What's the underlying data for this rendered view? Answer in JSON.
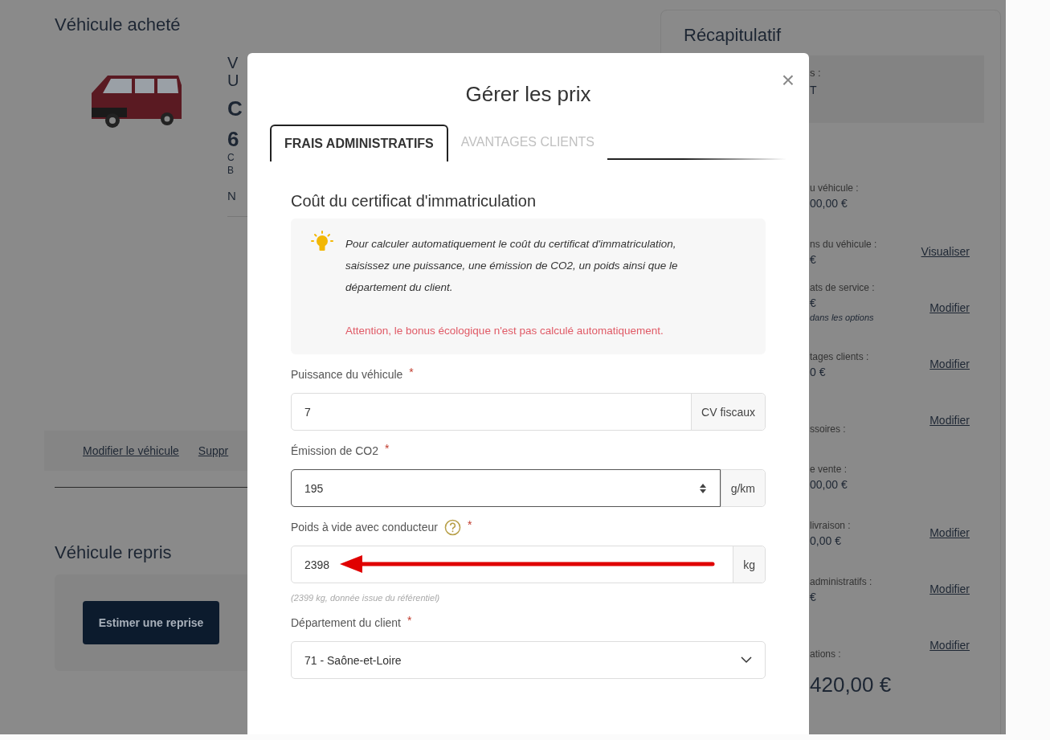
{
  "page": {
    "purchased_title": "Véhicule acheté",
    "vehicle_fragments": [
      {
        "text": "V",
        "kind": "large"
      },
      {
        "text": "U",
        "kind": "large"
      },
      {
        "text": "C",
        "kind": "huge"
      },
      {
        "text": "6",
        "kind": "huge"
      },
      {
        "text": "C",
        "kind": "small"
      },
      {
        "text": "B",
        "kind": "small"
      },
      {
        "text": "N",
        "kind": "medium"
      }
    ],
    "actions": [
      "Modifier le véhicule",
      "Suppr"
    ],
    "tradein_title": "Véhicule repris",
    "tradein_button": "Estimer une reprise"
  },
  "summary": {
    "title": "Récapitulatif",
    "box_lines": [
      "s :",
      "T"
    ],
    "rows": [
      {
        "label": "u véhicule :",
        "value": "00,00 €"
      },
      {
        "label": "ns du véhicule :",
        "value": "€",
        "link": "Visualiser"
      },
      {
        "label": "ats de service :",
        "value": "€",
        "note": "dans les options",
        "link": "Modifier"
      },
      {
        "label": "tages clients :",
        "value": "0 €",
        "link": "Modifier"
      },
      {
        "label": "ssoires :",
        "link": "Modifier"
      },
      {
        "label": "e vente :",
        "value": "00,00 €"
      },
      {
        "label": "livraison :",
        "value": "0,00 €",
        "link": "Modifier"
      },
      {
        "label": "administratifs :",
        "value": "€",
        "link": "Modifier"
      },
      {
        "label": "ations :",
        "link": "Modifier"
      }
    ],
    "total": "420,00 €"
  },
  "modal": {
    "title": "Gérer les prix",
    "close": "×",
    "tabs": [
      {
        "label": "FRAIS ADMINISTRATIFS",
        "selected": true
      },
      {
        "label": "AVANTAGES CLIENTS",
        "selected": false
      }
    ],
    "section_title": "Coût du certificat d'immatriculation",
    "info": {
      "text": "Pour calculer automatiquement le coût du certificat d'immatriculation, saisissez une puissance, une émission de CO2, un poids ainsi que le département du client.",
      "warning": "Attention, le bonus écologique n'est pas calculé automatiquement."
    },
    "fields": [
      {
        "kind": "addon",
        "label": "Puissance du véhicule",
        "required_mark": "*",
        "value": "7",
        "unit": "CV fiscaux"
      },
      {
        "kind": "number",
        "label": "Émission de CO2",
        "required_mark": "*",
        "value": "195",
        "unit": "g/km"
      },
      {
        "kind": "addon",
        "label": "Poids à vide avec conducteur",
        "help": true,
        "required_mark": "*",
        "value": "2398",
        "unit": "kg",
        "annotated": true,
        "hint": "(2399 kg, donnée issue du référentiel)"
      },
      {
        "kind": "select",
        "label": "Département du client",
        "required_mark": "*",
        "value": "71 - Saône-et-Loire"
      }
    ]
  }
}
